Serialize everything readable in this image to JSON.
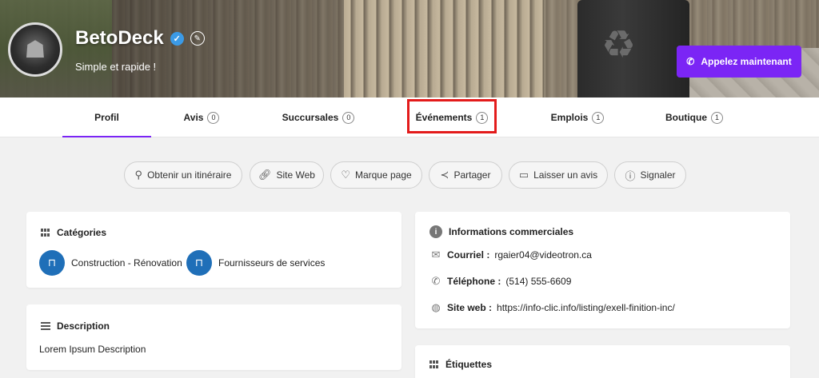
{
  "header": {
    "title": "BetoDeck",
    "tagline": "Simple et rapide !",
    "call_button": "Appelez maintenant"
  },
  "tabs": [
    {
      "label": "Profil",
      "count": null
    },
    {
      "label": "Avis",
      "count": "0"
    },
    {
      "label": "Succursales",
      "count": "0"
    },
    {
      "label": "Événements",
      "count": "1"
    },
    {
      "label": "Emplois",
      "count": "1"
    },
    {
      "label": "Boutique",
      "count": "1"
    }
  ],
  "actions": [
    {
      "label": "Obtenir un itinéraire",
      "icon": "map-pin-icon"
    },
    {
      "label": "Site Web",
      "icon": "link-icon"
    },
    {
      "label": "Marque page",
      "icon": "heart-icon"
    },
    {
      "label": "Partager",
      "icon": "share-icon"
    },
    {
      "label": "Laisser un avis",
      "icon": "comment-icon"
    },
    {
      "label": "Signaler",
      "icon": "warning-icon"
    }
  ],
  "categories": {
    "title": "Catégories",
    "items": [
      "Construction - Rénovation",
      "Fournisseurs de services"
    ]
  },
  "description": {
    "title": "Description",
    "text": "Lorem Ipsum Description"
  },
  "business_info": {
    "title": "Informations commerciales",
    "email_label": "Courriel :",
    "email": "rgaier04@videotron.ca",
    "phone_label": "Téléphone :",
    "phone": "(514) 555-6609",
    "website_label": "Site web :",
    "website": "https://info-clic.info/listing/exell-finition-inc/"
  },
  "tags": {
    "title": "Étiquettes"
  },
  "colors": {
    "accent": "#7b25f5",
    "category_icon": "#1f6fb8",
    "highlight": "#e31b1b"
  }
}
